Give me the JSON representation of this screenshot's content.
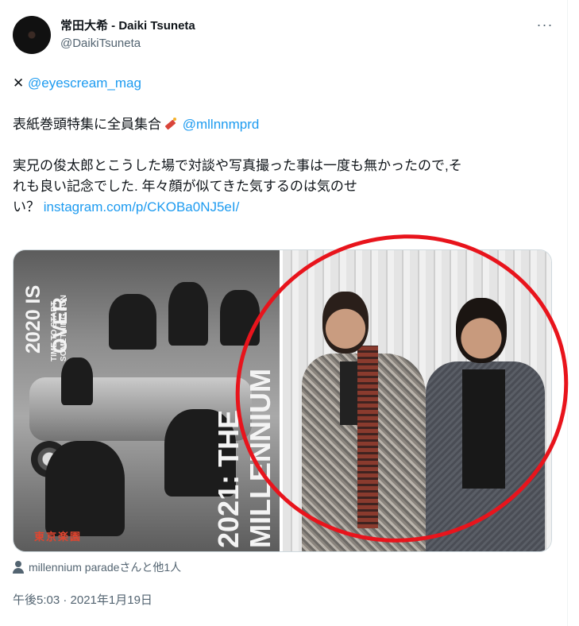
{
  "author": {
    "display_name": "常田大希 - Daiki Tsuneta",
    "handle": "@DaikiTsuneta",
    "more_icon": "more-horizontal-icon",
    "more_glyph": "···"
  },
  "tweet": {
    "line1_prefix": "✕",
    "line1_mention": "@eyescream_mag",
    "line2_text": "表紙巻頭特集に全員集合",
    "line2_emoji": "firecracker-emoji",
    "line2_mention": "@mllnnmprd",
    "line3_text": "実兄の俊太郎とこうした場で対談や写真撮った事は一度も無かったので,そ",
    "line4_text": "れも良い記念でした. 年々顔が似てきた気するのは気のせ",
    "line5_text": "い？",
    "line5_link": "instagram.com/p/CKOBa0NJ5eI/"
  },
  "media": {
    "left_photo": {
      "cover_text_2020": "2020 IS OVER",
      "cover_text_small": "TIME TO START SOMETHING FUN",
      "cover_text_big": "2021: THE MILLENNIUM",
      "cover_stamp": "東京楽園"
    },
    "annotation_color": "#e8141c"
  },
  "tagged_users": "millennium paradeさんと他1人",
  "timestamp": "午後5:03 · 2021年1月19日",
  "colors": {
    "text_primary": "#0f1419",
    "text_secondary": "#536471",
    "link": "#1d9bf0"
  }
}
